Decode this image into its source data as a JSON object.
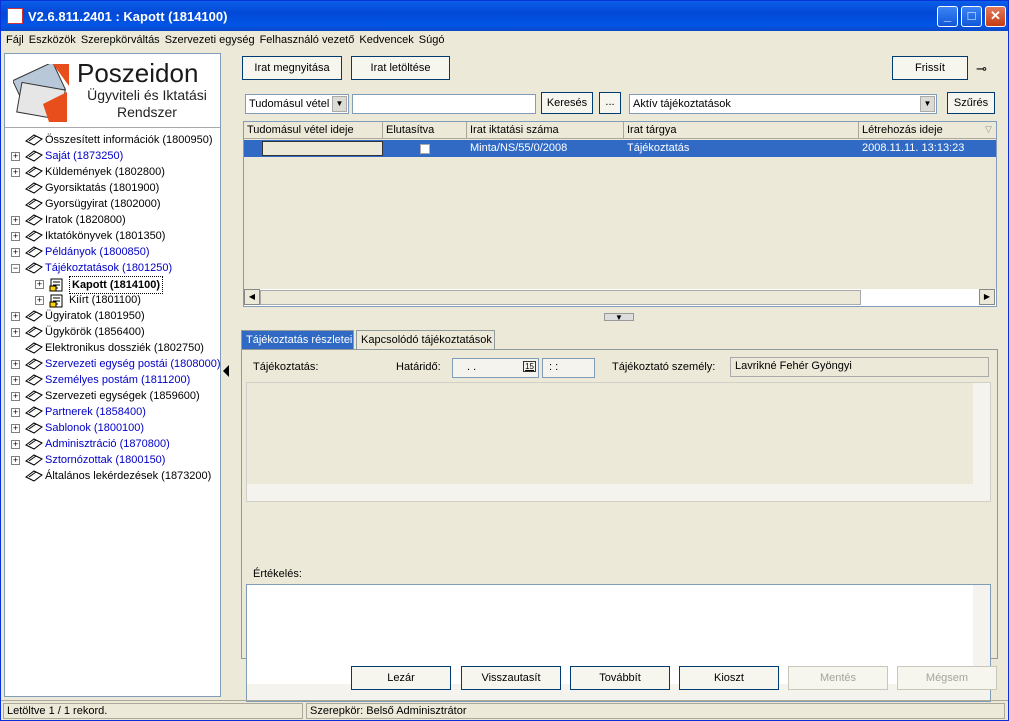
{
  "window": {
    "title": "V2.6.811.2401 : Kapott (1814100)"
  },
  "menu": [
    "Fájl",
    "Eszközök",
    "Szerepkörváltás",
    "Szervezeti egység",
    "Felhasználó vezető",
    "Kedvencek",
    "Súgó"
  ],
  "logo": {
    "line1": "Poszeidon",
    "line2": "Ügyviteli és Iktatási",
    "line3": "Rendszer"
  },
  "tree": [
    {
      "label": "Összesített információk (1800950)",
      "level": 0,
      "expander": false,
      "blue": false
    },
    {
      "label": "Saját (1873250)",
      "level": 0,
      "expander": true,
      "blue": true
    },
    {
      "label": "Küldemények (1802800)",
      "level": 0,
      "expander": true,
      "blue": false
    },
    {
      "label": "Gyorsiktatás (1801900)",
      "level": 0,
      "expander": false,
      "blue": false
    },
    {
      "label": "Gyorsügyirat (1802000)",
      "level": 0,
      "expander": false,
      "blue": false
    },
    {
      "label": "Iratok (1820800)",
      "level": 0,
      "expander": true,
      "blue": false
    },
    {
      "label": "Iktatókönyvek (1801350)",
      "level": 0,
      "expander": true,
      "blue": false
    },
    {
      "label": "Példányok (1800850)",
      "level": 0,
      "expander": true,
      "blue": true
    },
    {
      "label": "Tájékoztatások (1801250)",
      "level": 0,
      "expander": "minus",
      "blue": true
    },
    {
      "label": "Kapott (1814100)",
      "level": 1,
      "expander": true,
      "blue": false,
      "selected": true
    },
    {
      "label": "Kiírt (1801100)",
      "level": 1,
      "expander": true,
      "blue": false
    },
    {
      "label": "Ügyiratok (1801950)",
      "level": 0,
      "expander": true,
      "blue": false
    },
    {
      "label": "Ügykörök (1856400)",
      "level": 0,
      "expander": true,
      "blue": false
    },
    {
      "label": "Elektronikus dossziék (1802750)",
      "level": 0,
      "expander": false,
      "blue": false
    },
    {
      "label": "Szervezeti egység postái (1808000)",
      "level": 0,
      "expander": true,
      "blue": true
    },
    {
      "label": "Személyes postám (1811200)",
      "level": 0,
      "expander": true,
      "blue": true
    },
    {
      "label": "Szervezeti egységek (1859600)",
      "level": 0,
      "expander": true,
      "blue": false
    },
    {
      "label": "Partnerek (1858400)",
      "level": 0,
      "expander": true,
      "blue": true
    },
    {
      "label": "Sablonok (1800100)",
      "level": 0,
      "expander": true,
      "blue": true
    },
    {
      "label": "Adminisztráció (1870800)",
      "level": 0,
      "expander": true,
      "blue": true
    },
    {
      "label": "Sztornózottak (1800150)",
      "level": 0,
      "expander": true,
      "blue": true
    },
    {
      "label": "Általános lekérdezések (1873200)",
      "level": 0,
      "expander": false,
      "blue": false
    }
  ],
  "toolbar": {
    "open": "Irat megnyitása",
    "download": "Irat letöltése",
    "refresh": "Frissít"
  },
  "filter": {
    "field": "Tudomásul vétel",
    "value": "",
    "search": "Keresés",
    "more": "...",
    "view": "Aktív tájékoztatások",
    "apply": "Szűrés"
  },
  "grid": {
    "columns": [
      "Tudomásul vétel ideje",
      "Elutasítva",
      "Irat iktatási száma",
      "Irat tárgya",
      "Létrehozás ideje"
    ],
    "rows": [
      [
        "",
        "",
        "Minta/NS/55/0/2008",
        "Tájékoztatás",
        "2008.11.11. 13:13:23"
      ]
    ]
  },
  "tabs": [
    "Tájékoztatás részletei",
    "Kapcsolódó tájékoztatások"
  ],
  "details": {
    "info_label": "Tájékoztatás:",
    "deadline_label": "Határidő:",
    "deadline_value": ". .",
    "deadline_time": ": :",
    "calendar": "15",
    "person_label": "Tájékoztató személy:",
    "person_value": "Lavrikné Fehér Gyöngyi",
    "eval_label": "Értékelés:"
  },
  "actions": {
    "close": "Lezár",
    "reject": "Visszautasít",
    "forward": "Továbbít",
    "assign": "Kioszt",
    "save": "Mentés",
    "cancel": "Mégsem"
  },
  "status": {
    "records": "Letöltve 1 / 1 rekord.",
    "role": "Szerepkör: Belső Adminisztrátor"
  }
}
